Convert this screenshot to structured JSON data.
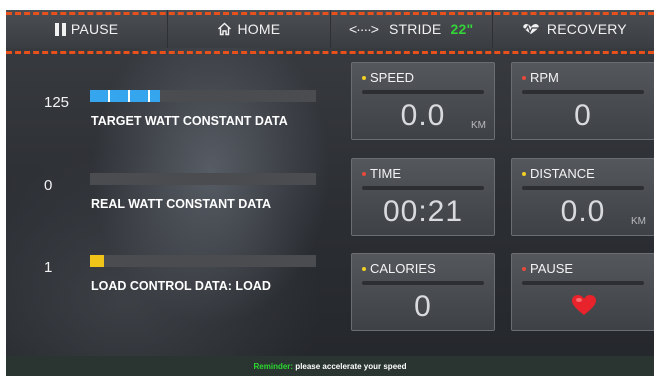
{
  "nav": {
    "pause_label": "PAUSE",
    "home_label": "HOME",
    "stride_label": "STRIDE",
    "stride_value": "22\"",
    "recovery_label": "RECOVERY"
  },
  "left_rows": [
    {
      "value": "125",
      "label": "TARGET WATT CONSTANT DATA",
      "bar_color": "#35a6ee",
      "bar_fraction": 0.31
    },
    {
      "value": "0",
      "label": "REAL WATT CONSTANT DATA",
      "bar_color": "#35a6ee",
      "bar_fraction": 0
    },
    {
      "value": "1",
      "label": "LOAD CONTROL DATA: LOAD",
      "bar_color": "#f0c418",
      "bar_fraction": 0.06
    }
  ],
  "cards": {
    "speed": {
      "title": "SPEED",
      "value": "0.0",
      "unit": "KM",
      "dot": "yellow"
    },
    "rpm": {
      "title": "RPM",
      "value": "0",
      "dot": "red"
    },
    "time": {
      "title": "TIME",
      "value": "00:21",
      "dot": "red"
    },
    "distance": {
      "title": "DISTANCE",
      "value": "0.0",
      "unit": "KM",
      "dot": "yellow"
    },
    "calories": {
      "title": "CALORIES",
      "value": "0",
      "dot": "yellow"
    },
    "pause": {
      "title": "PAUSE",
      "dot": "red",
      "icon": "heart-icon"
    }
  },
  "reminder": {
    "key": "Reminder:",
    "text": " please accelerate your speed"
  },
  "colors": {
    "accent_dashes": "#e8501c",
    "stride_green": "#35d23a",
    "heart_red": "#e8232b"
  }
}
